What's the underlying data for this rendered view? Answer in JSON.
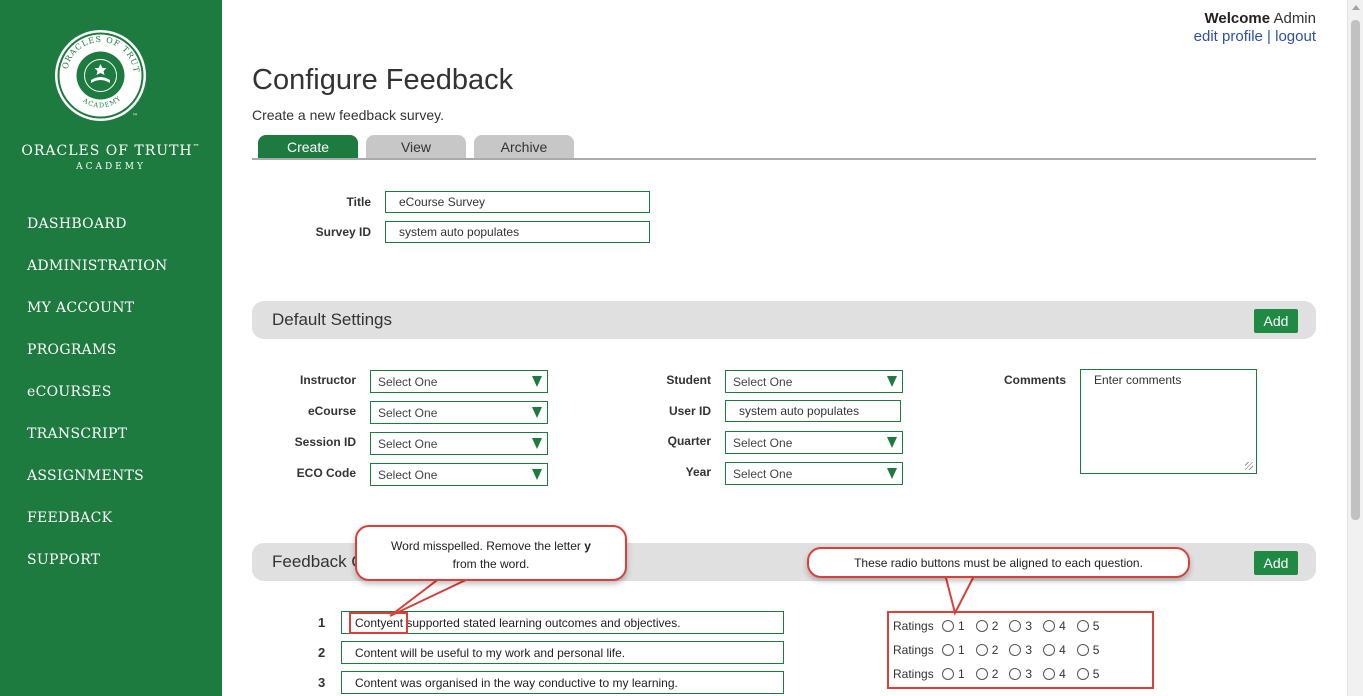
{
  "sidebar": {
    "logo_text": "ORACLES OF TRUTH ACADEMY",
    "brand_line1": "ORACLES OF TRUTH",
    "brand_tm": "™",
    "brand_line2": "ACADEMY",
    "items": [
      {
        "label": "DASHBOARD"
      },
      {
        "label": "ADMINISTRATION"
      },
      {
        "label": "MY ACCOUNT"
      },
      {
        "label": "PROGRAMS"
      },
      {
        "label": "eCOURSES"
      },
      {
        "label": "TRANSCRIPT"
      },
      {
        "label": "ASSIGNMENTS"
      },
      {
        "label": "FEEDBACK"
      },
      {
        "label": "SUPPORT"
      }
    ]
  },
  "header": {
    "welcome": "Welcome",
    "user": "Admin",
    "edit_profile": "edit profile",
    "separator": "|",
    "logout": "logout"
  },
  "page": {
    "title": "Configure Feedback",
    "subtitle": "Create a new feedback survey.",
    "tabs": [
      {
        "label": "Create"
      },
      {
        "label": "View"
      },
      {
        "label": "Archive"
      }
    ]
  },
  "survey": {
    "title_label": "Title",
    "title_value": "eCourse Survey",
    "id_label": "Survey ID",
    "id_value": "system auto populates"
  },
  "defaults": {
    "heading": "Default Settings",
    "add": "Add",
    "instructor_label": "Instructor",
    "ecourse_label": "eCourse",
    "session_label": "Session ID",
    "eco_label": "ECO Code",
    "student_label": "Student",
    "userid_label": "User ID",
    "quarter_label": "Quarter",
    "year_label": "Year",
    "comments_label": "Comments",
    "select_one": "Select One",
    "userid_value": "system auto populates",
    "comments_placeholder": "Enter comments"
  },
  "feedback": {
    "heading": "Feedback Q",
    "add": "Add",
    "questions": [
      {
        "num": "1",
        "text": "Contyent supported stated learning outcomes and objectives."
      },
      {
        "num": "2",
        "text": "Content will be useful to my work and personal life."
      },
      {
        "num": "3",
        "text": "Content was organised in the way conductive to my learning."
      }
    ],
    "ratings_label": "Ratings",
    "rating_values": [
      "1",
      "2",
      "3",
      "4",
      "5"
    ]
  },
  "annotations": {
    "callout1_line1": "Word misspelled. Remove the letter",
    "callout1_bold": "y",
    "callout1_line2": "from the word.",
    "callout2": "These radio buttons must be aligned to each question."
  },
  "colors": {
    "brand_green": "#1e7b3f",
    "button_green": "#1e8a44",
    "annotation_red": "#d9403a",
    "link_blue": "#2f4ea8"
  }
}
